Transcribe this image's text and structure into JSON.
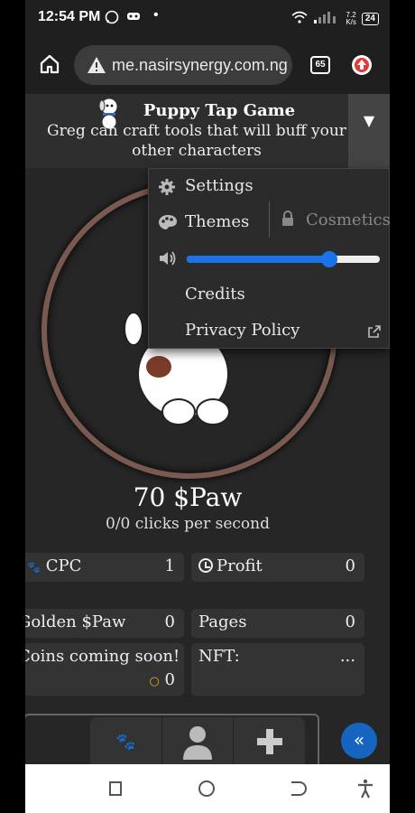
{
  "status_bar": {
    "time": "12:54 PM",
    "net_speed_top": "7.2",
    "net_speed_unit": "K/s",
    "battery": "24"
  },
  "browser": {
    "url": "me.nasirsynergy.com.ng",
    "tab_count": "65"
  },
  "header": {
    "title": "Puppy Tap Game",
    "subtitle": "Greg can craft tools that will buff your other characters",
    "toggle_glyph": "▼"
  },
  "menu": {
    "settings": "Settings",
    "themes": "Themes",
    "cosmetics": "Cosmetics",
    "volume_level": 0.74,
    "credits": "Credits",
    "privacy_policy": "Privacy Policy"
  },
  "game": {
    "paw_count": "70 $Paw",
    "clicks_per_second": "0/0 clicks per second",
    "cards": {
      "cpc_label": "CPC",
      "cpc_value": "1",
      "profit_label": "Profit",
      "profit_value": "0",
      "golden_label": "Golden $Paw",
      "golden_value": "0",
      "pages_label": "Pages",
      "pages_value": "0",
      "coins_label": "Coins coming soon!",
      "coins_value": "0",
      "nft_label": "NFT:",
      "nft_value": "..."
    }
  },
  "fab": {
    "glyph": "«"
  },
  "colors": {
    "accent": "#1a73e8",
    "ring": "#7a5a50",
    "fab": "#1565c0"
  }
}
